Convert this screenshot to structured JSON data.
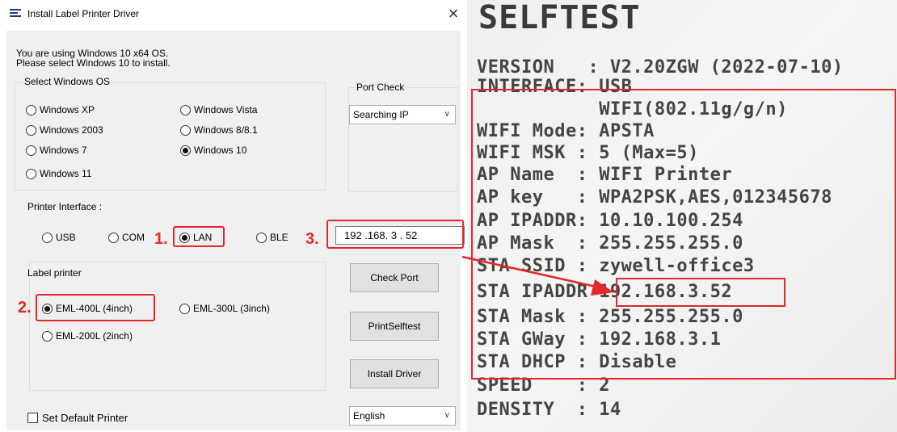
{
  "window": {
    "title": "Install Label Printer Driver",
    "close_glyph": "×"
  },
  "info": {
    "line1": "You are using Windows 10 x64 OS.",
    "line2": "Please select Windows 10 to install."
  },
  "os_group": {
    "label": "Select Windows OS",
    "options": [
      {
        "label": "Windows XP",
        "selected": false
      },
      {
        "label": "Windows Vista",
        "selected": false
      },
      {
        "label": "Windows 2003",
        "selected": false
      },
      {
        "label": "Windows 8/8.1",
        "selected": false
      },
      {
        "label": "Windows 7",
        "selected": false
      },
      {
        "label": "Windows 10",
        "selected": true
      },
      {
        "label": "Windows 11",
        "selected": false
      }
    ]
  },
  "port_check": {
    "label": "Port Check",
    "selected": "Searching IP"
  },
  "interface": {
    "label": "Printer Interface :",
    "options": [
      {
        "label": "USB",
        "selected": false
      },
      {
        "label": "COM",
        "selected": false
      },
      {
        "label": "LAN",
        "selected": true
      },
      {
        "label": "BLE",
        "selected": false
      }
    ],
    "ip_value": "192 .168. 3  . 52"
  },
  "label_printer": {
    "label": "Label printer",
    "options": [
      {
        "label": "EML-400L (4inch)",
        "selected": true
      },
      {
        "label": "EML-300L (3inch)",
        "selected": false
      },
      {
        "label": "EML-200L (2inch)",
        "selected": false
      }
    ]
  },
  "buttons": {
    "check_port": "Check Port",
    "print_selftest": "PrintSelftest",
    "install_driver": "Install Driver"
  },
  "default_printer": {
    "label": "Set Default Printer",
    "checked": false
  },
  "language": {
    "selected": "English"
  },
  "annotations": {
    "step1": "1.",
    "step2": "2.",
    "step3": "3.",
    "color": "#e5262b"
  },
  "selftest": {
    "title": "SELFTEST",
    "lines": [
      "VERSION   : V2.20ZGW (2022-07-10)",
      "INTERFACE: USB",
      "           WIFI(802.11g/g/n)",
      "WIFI Mode: APSTA",
      "WIFI MSK : 5 (Max=5)",
      "AP Name  : WIFI Printer",
      "AP key   : WPA2PSK,AES,012345678",
      "AP IPADDR: 10.10.100.254",
      "AP Mask  : 255.255.255.0",
      "STA SSID : zywell-office3",
      "STA IPADDR 192.168.3.52",
      "STA Mask : 255.255.255.0",
      "STA GWay : 192.168.3.1",
      "STA DHCP : Disable",
      "SPEED    : 2",
      "DENSITY  : 14"
    ]
  },
  "icons": {
    "app": "app-icon",
    "close": "close-icon",
    "chevron": "chevron-down-icon",
    "arrow": "red-arrow-icon"
  }
}
